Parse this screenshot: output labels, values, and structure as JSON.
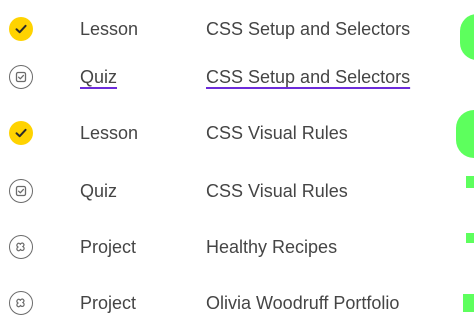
{
  "colors": {
    "complete_badge": "#ffd300",
    "link_underline": "#6c2bd9",
    "highlight": "#5dff5d"
  },
  "items": [
    {
      "icon": "check-icon",
      "type": "Lesson",
      "title": "CSS Setup and Selectors",
      "completed": true,
      "link": false
    },
    {
      "icon": "quiz-icon",
      "type": "Quiz",
      "title": "CSS Setup and Selectors",
      "completed": false,
      "link": true
    },
    {
      "icon": "check-icon",
      "type": "Lesson",
      "title": "CSS Visual Rules",
      "completed": true,
      "link": false
    },
    {
      "icon": "quiz-icon",
      "type": "Quiz",
      "title": "CSS Visual Rules",
      "completed": false,
      "link": false
    },
    {
      "icon": "project-icon",
      "type": "Project",
      "title": "Healthy Recipes",
      "completed": false,
      "link": false
    },
    {
      "icon": "project-icon",
      "type": "Project",
      "title": "Olivia Woodruff Portfolio",
      "completed": false,
      "link": false
    }
  ]
}
